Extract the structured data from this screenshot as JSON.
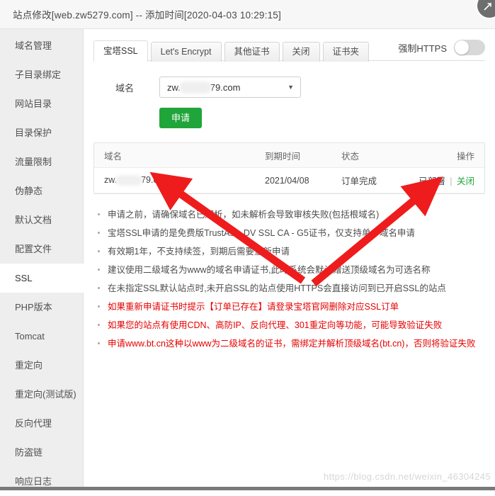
{
  "window": {
    "title": "站点修改[web.zw5279.com] -- 添加时间[2020-04-03 10:29:15]",
    "control_icon": "resize-icon"
  },
  "sidebar": {
    "items": [
      {
        "label": "域名管理",
        "active": false
      },
      {
        "label": "子目录绑定",
        "active": false
      },
      {
        "label": "网站目录",
        "active": false
      },
      {
        "label": "目录保护",
        "active": false
      },
      {
        "label": "流量限制",
        "active": false
      },
      {
        "label": "伪静态",
        "active": false
      },
      {
        "label": "默认文档",
        "active": false
      },
      {
        "label": "配置文件",
        "active": false
      },
      {
        "label": "SSL",
        "active": true
      },
      {
        "label": "PHP版本",
        "active": false
      },
      {
        "label": "Tomcat",
        "active": false
      },
      {
        "label": "重定向",
        "active": false
      },
      {
        "label": "重定向(测试版)",
        "active": false
      },
      {
        "label": "反向代理",
        "active": false
      },
      {
        "label": "防盗链",
        "active": false
      },
      {
        "label": "响应日志",
        "active": false
      }
    ]
  },
  "tabs": [
    {
      "label": "宝塔SSL",
      "active": true
    },
    {
      "label": "Let's Encrypt",
      "active": false
    },
    {
      "label": "其他证书",
      "active": false
    },
    {
      "label": "关闭",
      "active": false
    },
    {
      "label": "证书夹",
      "active": false
    }
  ],
  "force_https": {
    "label": "强制HTTPS",
    "state": "off"
  },
  "form": {
    "domain_label": "域名",
    "domain_value_prefix": "zw.",
    "domain_value_suffix": "79.com",
    "domain_masked": true,
    "caret_icon": "chevron-down-icon",
    "apply_label": "申请"
  },
  "table": {
    "headers": {
      "domain": "域名",
      "expire": "到期时间",
      "status": "状态",
      "action": "操作"
    },
    "rows": [
      {
        "domain_prefix": "zw.",
        "domain_suffix": "79.com",
        "expire": "2021/04/08",
        "status": "订单完成",
        "action_deployed": "已部署",
        "action_sep": "|",
        "action_close": "关闭"
      }
    ]
  },
  "notes": [
    {
      "text": "申请之前，请确保域名已解析，如未解析会导致审核失败(包括根域名)",
      "warn": false
    },
    {
      "text": "宝塔SSL申请的是免费版TrustAsia DV SSL CA - G5证书，仅支持单个域名申请",
      "warn": false
    },
    {
      "text": "有效期1年，不支持续签，到期后需要重新申请",
      "warn": false
    },
    {
      "text": "建议使用二级域名为www的域名申请证书,此时系统会默认赠送顶级域名为可选名称",
      "warn": false
    },
    {
      "text": "在未指定SSL默认站点时,未开启SSL的站点使用HTTPS会直接访问到已开启SSL的站点",
      "warn": false
    },
    {
      "text": "如果重新申请证书时提示【订单已存在】请登录宝塔官网删除对应SSL订单",
      "warn": true
    },
    {
      "text": "如果您的站点有使用CDN、高防IP、反向代理、301重定向等功能，可能导致验证失败",
      "warn": true
    },
    {
      "text": "申请www.bt.cn这种以www为二级域名的证书，需绑定并解析顶级域名(bt.cn)，否则将验证失败",
      "warn": true
    }
  ],
  "annotations": {
    "arrow_color": "#ee1c1c",
    "arrow_1_target": "domain-cell",
    "arrow_2_target": "deploy-status"
  },
  "watermark": {
    "text": "https://blog.csdn.net/weixin_46304245"
  }
}
